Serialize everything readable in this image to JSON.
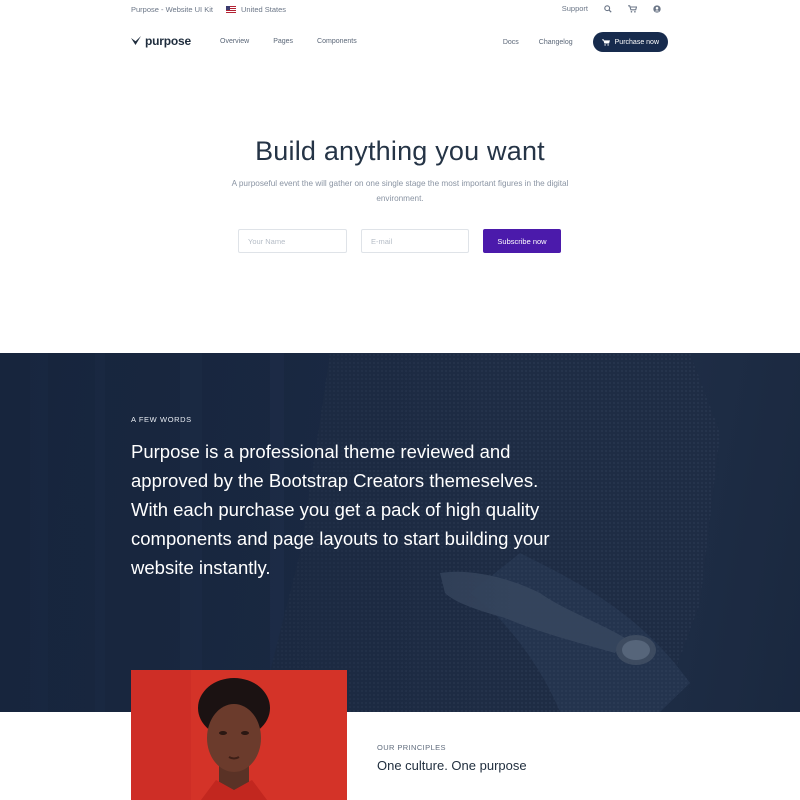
{
  "topbar": {
    "kit_name": "Purpose - Website UI Kit",
    "country": "United States",
    "support": "Support",
    "icons": [
      "search-icon",
      "cart-icon",
      "user-icon"
    ]
  },
  "nav": {
    "brand": "purpose",
    "links": [
      "Overview",
      "Pages",
      "Components"
    ],
    "docs": "Docs",
    "changelog": "Changelog",
    "purchase": "Purchase now"
  },
  "hero": {
    "title": "Build anything you want",
    "subtitle": "A purposeful event the will gather on one single stage the most important figures in the digital environment.",
    "name_placeholder": "Your Name",
    "email_placeholder": "E-mail",
    "subscribe": "Subscribe now"
  },
  "about": {
    "eyebrow": "A FEW WORDS",
    "text": "Purpose is a professional theme reviewed and approved by the Bootstrap Creators themeselves. With each purchase you get a pack of high quality components and page layouts to start building your website instantly."
  },
  "principles": {
    "eyebrow": "OUR PRINCIPLES",
    "title": "One culture. One purpose"
  },
  "colors": {
    "primary_dark": "#172b4d",
    "accent_purple": "#4b1aab",
    "band_bg": "#1b2b45",
    "portrait_red": "#d8312a"
  }
}
